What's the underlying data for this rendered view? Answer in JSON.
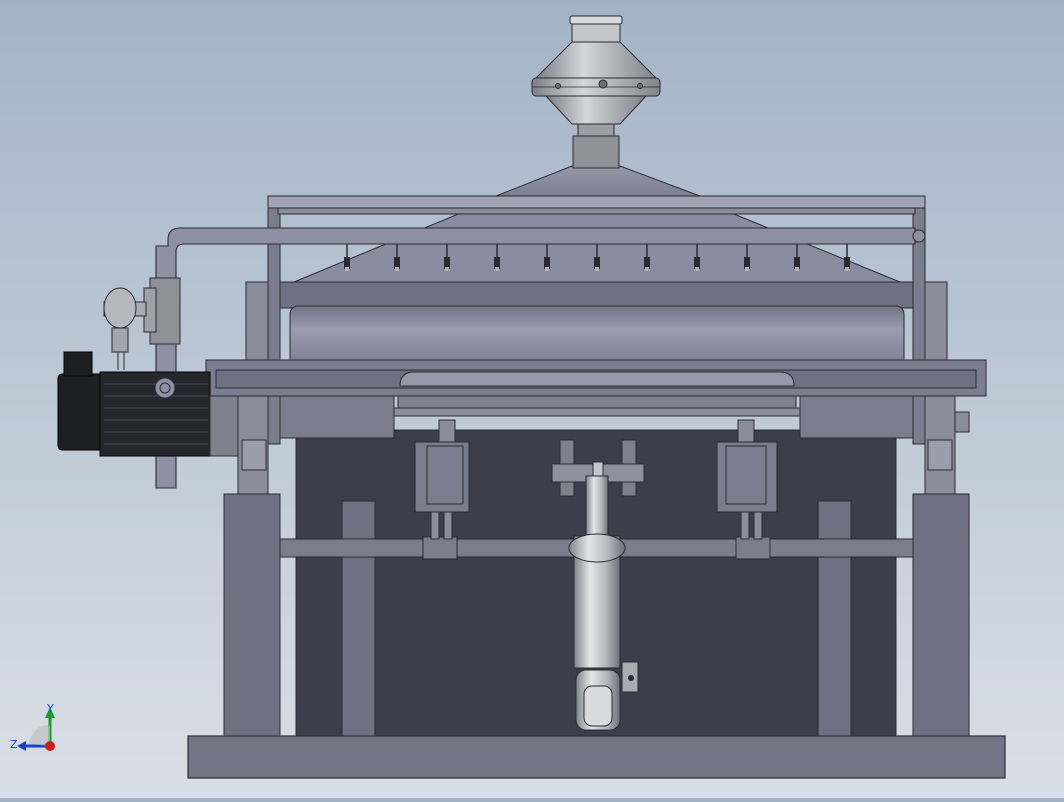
{
  "viewport": {
    "background_top": "#a3b3c7",
    "background_bottom": "#d9dfe6"
  },
  "triad": {
    "y_label": "Y",
    "z_label": "Z",
    "x_axis_color": "#d11c1c",
    "y_axis_color": "#1c9a2b",
    "z_axis_color": "#1f3fbf"
  },
  "palette": {
    "frame": "#6e7182",
    "frame_light": "#8a8d9c",
    "dark_panel": "#3c3f4b",
    "motor": "#1e1f24",
    "steel": "#b9bcc2"
  },
  "icons": [
    "nozzle-icon",
    "triad-icon"
  ]
}
